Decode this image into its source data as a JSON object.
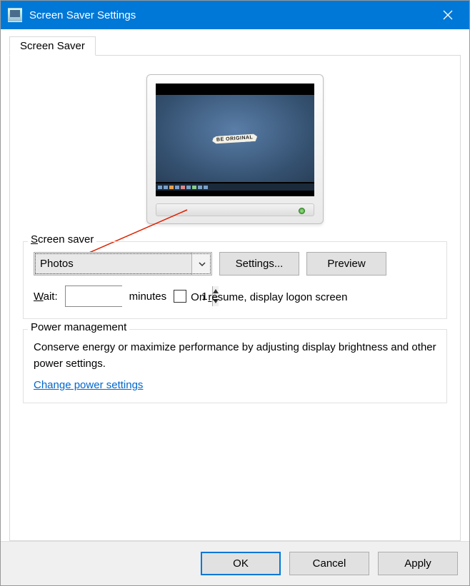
{
  "titlebar": {
    "title": "Screen Saver Settings"
  },
  "tab": {
    "label": "Screen Saver"
  },
  "monitor_preview": {
    "note_text": "BE ORIGINAL"
  },
  "screensaver_group": {
    "legend_prefix": "S",
    "legend_rest": "creen saver",
    "combo_value": "Photos",
    "settings_button": "Settings...",
    "preview_button": "Preview",
    "wait_label_prefix": "W",
    "wait_label_rest": "ait:",
    "wait_value": "1",
    "minutes_label": "minutes",
    "resume_label_prefix": "On ",
    "resume_label_u": "r",
    "resume_label_rest": "esume, display logon screen"
  },
  "power_group": {
    "legend": "Power management",
    "text": "Conserve energy or maximize performance by adjusting display brightness and other power settings.",
    "link": "Change power settings"
  },
  "footer": {
    "ok": "OK",
    "cancel": "Cancel",
    "apply": "Apply"
  }
}
